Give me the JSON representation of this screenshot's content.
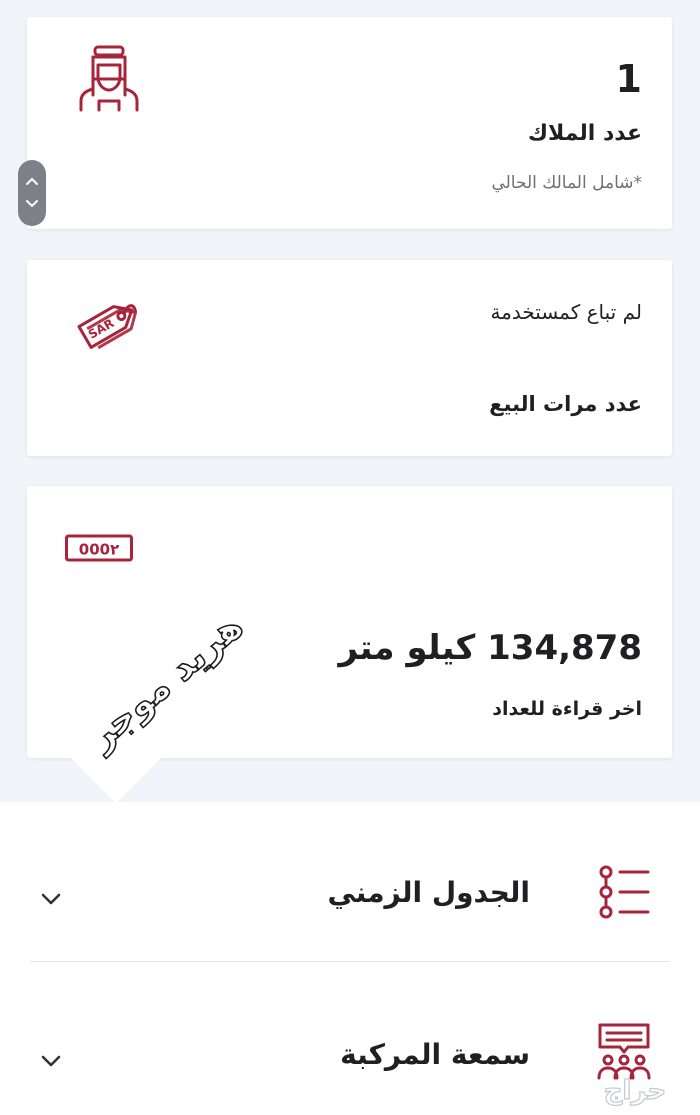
{
  "owners_card": {
    "count": "1",
    "label": "عدد الملاك",
    "note": "*شامل المالك الحالي",
    "icon": "person-ghutra-icon"
  },
  "sales_card": {
    "status": "لم تباع كمستخدمة",
    "label": "عدد مرات البيع",
    "icon": "sar-price-tag-icon",
    "tag_text": "SAR"
  },
  "odometer_card": {
    "value": "134,878 كيلو متر",
    "label": "اخر قراءة للعداد",
    "icon": "odometer-counter-icon",
    "counter_digits": "000٢"
  },
  "watermark": {
    "text": "هريد موجر"
  },
  "accordion": {
    "items": [
      {
        "label": "الجدول الزمني",
        "icon": "timeline-list-icon"
      },
      {
        "label": "سمعة المركبة",
        "icon": "reputation-group-icon"
      }
    ]
  },
  "footer": {
    "logo_text": "حراج"
  },
  "colors": {
    "accent": "#a8243a",
    "background": "#f3f4f9",
    "card": "#ffffff",
    "text": "#1f1f24",
    "muted": "#6f7076"
  }
}
